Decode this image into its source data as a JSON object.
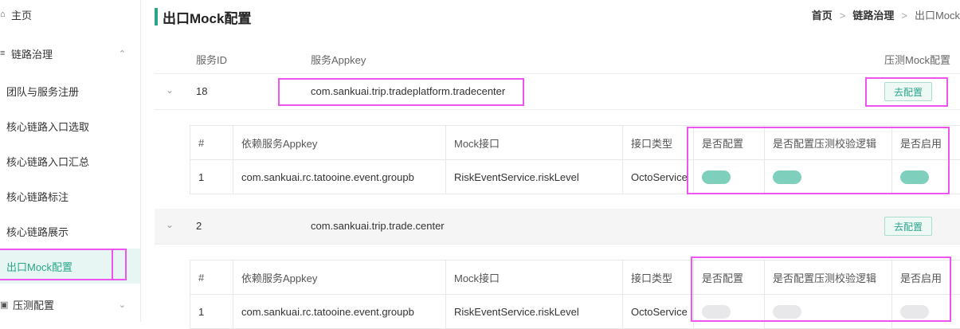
{
  "sidebar": {
    "items": [
      {
        "label": "主页",
        "icon": "home-icon",
        "icon_glyph": "⌂"
      },
      {
        "label": "链路治理",
        "icon": "link-icon",
        "icon_glyph": "≡",
        "caret": "⌃"
      },
      {
        "label": "团队与服务注册"
      },
      {
        "label": "核心链路入口选取"
      },
      {
        "label": "核心链路入口汇总"
      },
      {
        "label": "核心链路标注"
      },
      {
        "label": "核心链路展示"
      },
      {
        "label": "出口Mock配置"
      },
      {
        "label": "压测配置",
        "icon": "stress-icon",
        "icon_glyph": "▣",
        "caret": "⌄"
      }
    ]
  },
  "header": {
    "title": "出口Mock配置",
    "breadcrumb": [
      "首页",
      "链路治理",
      "出口Mock"
    ]
  },
  "table": {
    "columns": [
      "服务ID",
      "服务Appkey",
      "压测Mock配置"
    ],
    "rows": [
      {
        "id": "18",
        "appkey": "com.sankuai.trip.tradeplatform.tradecenter",
        "button": "去配置"
      },
      {
        "id": "2",
        "appkey": "com.sankuai.trip.trade.center",
        "button": "去配置"
      }
    ]
  },
  "inner_tables": [
    {
      "columns": [
        "#",
        "依赖服务Appkey",
        "Mock接口",
        "接口类型",
        "是否配置",
        "是否配置压测校验逻辑",
        "是否启用"
      ],
      "row": {
        "index": "1",
        "appkey": "com.sankuai.rc.tatooine.event.groupb",
        "api": "RiskEventService.riskLevel",
        "type": "OctoService"
      },
      "toggles": [
        true,
        true,
        true
      ]
    },
    {
      "columns": [
        "#",
        "依赖服务Appkey",
        "Mock接口",
        "接口类型",
        "是否配置",
        "是否配置压测校验逻辑",
        "是否启用"
      ],
      "row": {
        "index": "1",
        "appkey": "com.sankuai.rc.tatooine.event.groupb",
        "api": "RiskEventService.riskLevel",
        "type": "OctoService"
      },
      "toggles": [
        false,
        false,
        false
      ]
    }
  ],
  "colors": {
    "accent": "#2aa58a",
    "toggle_on": "#7fcfbd",
    "toggle_off": "#e8e8ea",
    "annotation": "#ee55ee"
  }
}
